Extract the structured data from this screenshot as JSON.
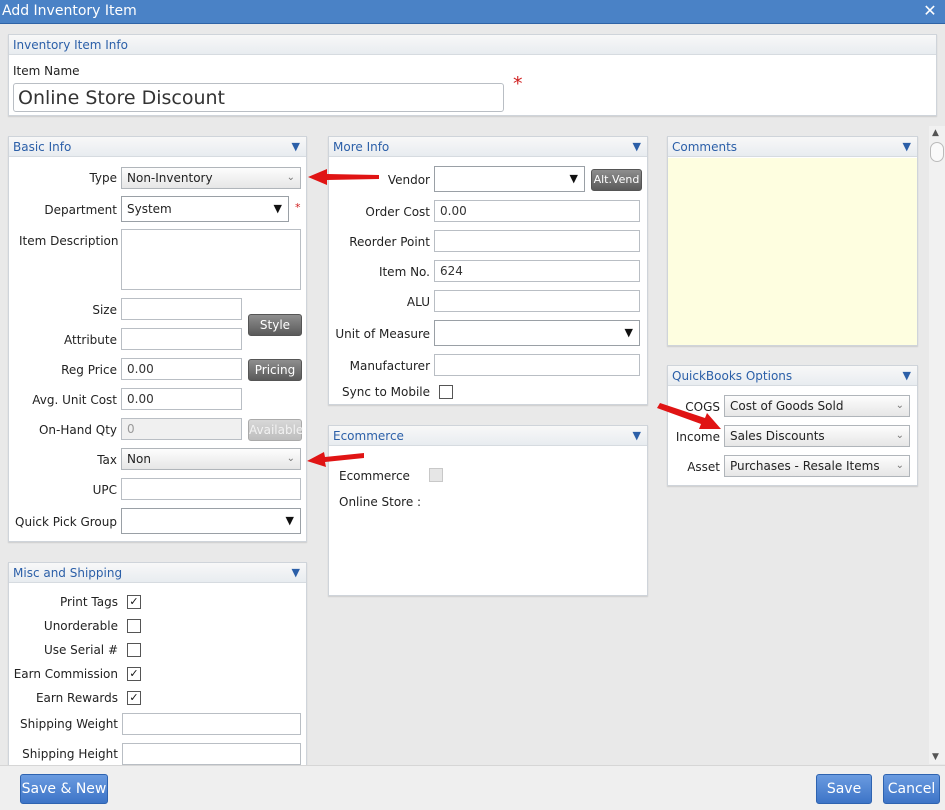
{
  "window": {
    "title": "Add Inventory Item",
    "close_icon": "close-icon"
  },
  "item_info": {
    "header": "Inventory Item Info",
    "item_name_label": "Item Name",
    "item_name_value": "Online Store Discount",
    "required_mark": "*"
  },
  "basic_info": {
    "header": "Basic Info",
    "type_label": "Type",
    "type_value": "Non-Inventory",
    "department_label": "Department",
    "department_value": "System",
    "department_required": "*",
    "description_label": "Item Description",
    "size_label": "Size",
    "attribute_label": "Attribute",
    "style_button": "Style",
    "reg_price_label": "Reg Price",
    "reg_price_value": "0.00",
    "pricing_button": "Pricing",
    "avg_cost_label": "Avg. Unit Cost",
    "avg_cost_value": "0.00",
    "onhand_label": "On-Hand Qty",
    "onhand_value": "0",
    "available_button": "Available",
    "tax_label": "Tax",
    "tax_value": "Non",
    "upc_label": "UPC",
    "quick_pick_label": "Quick Pick Group"
  },
  "misc_shipping": {
    "header": "Misc and Shipping",
    "print_tags_label": "Print Tags",
    "print_tags_checked": "✓",
    "unorderable_label": "Unorderable",
    "use_serial_label": "Use Serial #",
    "earn_commission_label": "Earn Commission",
    "earn_commission_checked": "✓",
    "earn_rewards_label": "Earn Rewards",
    "earn_rewards_checked": "✓",
    "shipping_weight_label": "Shipping Weight",
    "shipping_height_label": "Shipping Height"
  },
  "more_info": {
    "header": "More Info",
    "vendor_label": "Vendor",
    "alt_vend_button": "Alt.Vend",
    "order_cost_label": "Order Cost",
    "order_cost_value": "0.00",
    "reorder_point_label": "Reorder Point",
    "item_no_label": "Item No.",
    "item_no_value": "624",
    "alu_label": "ALU",
    "uom_label": "Unit of Measure",
    "manufacturer_label": "Manufacturer",
    "sync_mobile_label": "Sync to Mobile"
  },
  "ecommerce": {
    "header": "Ecommerce",
    "ecommerce_label": "Ecommerce",
    "online_store_label": "Online Store :"
  },
  "comments": {
    "header": "Comments"
  },
  "quickbooks": {
    "header": "QuickBooks Options",
    "cogs_label": "COGS",
    "cogs_value": "Cost of Goods Sold",
    "income_label": "Income",
    "income_value": "Sales Discounts",
    "asset_label": "Asset",
    "asset_value": "Purchases - Resale Items"
  },
  "footer": {
    "save_new": "Save & New",
    "save": "Save",
    "cancel": "Cancel"
  },
  "icons": {
    "collapse": "▼",
    "chevron": "⌄",
    "dropdown": "▼",
    "close": "✕",
    "scroll_up": "▲",
    "scroll_down": "▼"
  },
  "colors": {
    "titlebar": "#4a82c6",
    "panel_title": "#2b5fa8",
    "comments_bg": "#fefee0",
    "annotation_arrow": "#e01414",
    "primary_button": "#3d74c7"
  }
}
